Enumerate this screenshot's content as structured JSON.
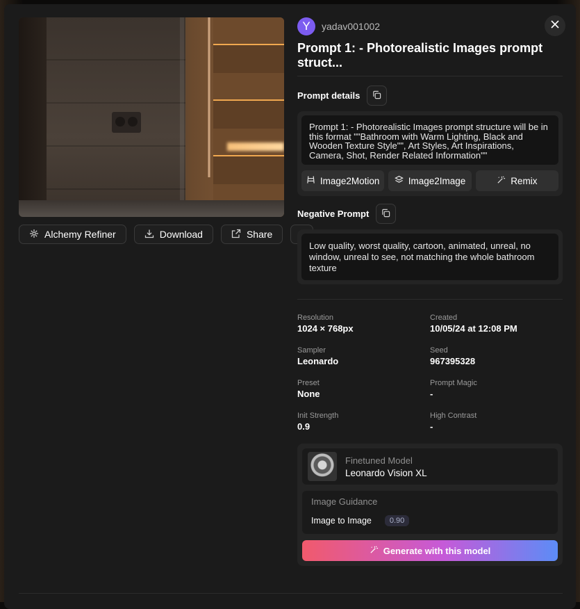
{
  "user": {
    "initial": "Y",
    "name": "yadav001002"
  },
  "title": "Prompt 1: - Photorealistic Images prompt struct...",
  "left_actions": {
    "alchemy_refiner": "Alchemy Refiner",
    "download": "Download",
    "share": "Share",
    "more": "···"
  },
  "prompt_details": {
    "heading": "Prompt details",
    "text": "Prompt 1: - Photorealistic Images prompt structure will be in this format \"\"Bathroom with Warm Lighting, Black and Wooden Texture Style\"\", Art Styles, Art Inspirations, Camera, Shot, Render Related Information\"\"",
    "tools": [
      "Image2Motion",
      "Image2Image",
      "Remix"
    ]
  },
  "negative_prompt": {
    "heading": "Negative Prompt",
    "text": "Low quality, worst quality, cartoon, animated, unreal, no window, unreal to see, not matching the whole bathroom texture"
  },
  "meta": [
    {
      "label": "Resolution",
      "value": "1024 × 768px"
    },
    {
      "label": "Created",
      "value": "10/05/24 at 12:08 PM"
    },
    {
      "label": "Sampler",
      "value": "Leonardo"
    },
    {
      "label": "Seed",
      "value": "967395328"
    },
    {
      "label": "Preset",
      "value": "None"
    },
    {
      "label": "Prompt Magic",
      "value": "-"
    },
    {
      "label": "Init Strength",
      "value": "0.9"
    },
    {
      "label": "High Contrast",
      "value": "-"
    }
  ],
  "model": {
    "label": "Finetuned Model",
    "name": "Leonardo Vision XL"
  },
  "guidance": {
    "title": "Image Guidance",
    "type": "Image to Image",
    "value": "0.90"
  },
  "generate_label": "Generate with this model",
  "colors": {
    "accent_start": "#f15a6c",
    "accent_end": "#5c8cf6",
    "avatar": "#7c5cf0",
    "modal_bg": "#1b1b1b"
  }
}
